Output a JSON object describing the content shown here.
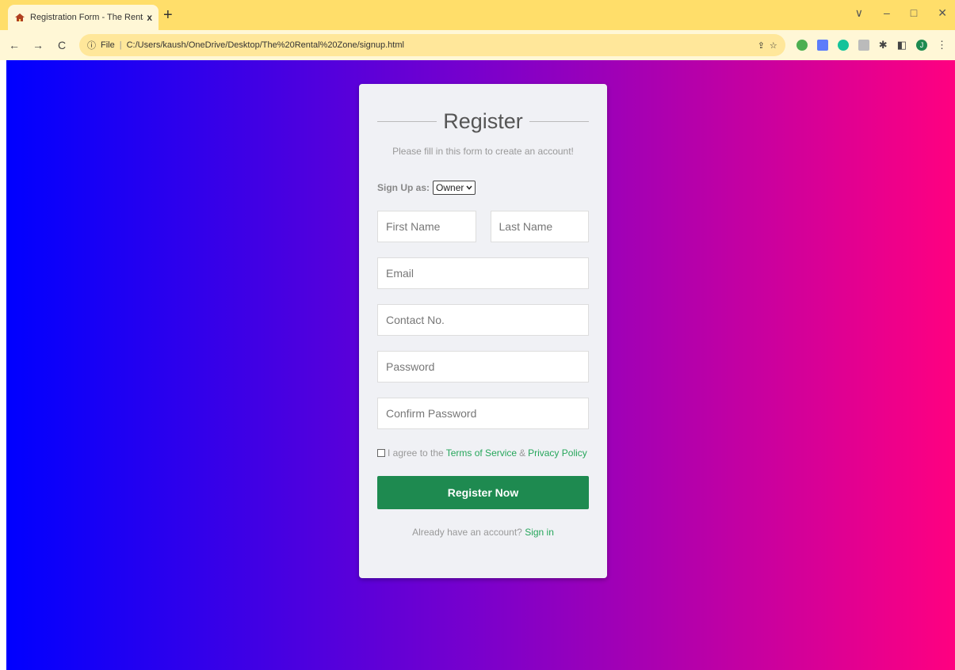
{
  "browser": {
    "tab_title": "Registration Form - The Rental Z",
    "tab_close": "x",
    "new_tab": "+",
    "file_label": "File",
    "url": "C:/Users/kaush/OneDrive/Desktop/The%20Rental%20Zone/signup.html",
    "window": {
      "chevron": "∨",
      "minimize": "–",
      "restore": "□",
      "close": "✕"
    },
    "nav": {
      "back": "←",
      "forward": "→",
      "reload": "C",
      "info": "ⓘ"
    },
    "profile_initial": "J"
  },
  "form": {
    "title": "Register",
    "subtitle": "Please fill in this form to create an account!",
    "signup_as_label": "Sign Up as:",
    "signup_as_value": "Owner",
    "first_name_placeholder": "First Name",
    "last_name_placeholder": "Last Name",
    "email_placeholder": "Email",
    "contact_placeholder": "Contact No.",
    "password_placeholder": "Password",
    "confirm_password_placeholder": "Confirm Password",
    "agree_prefix": "I agree to the",
    "terms_link": "Terms of Service",
    "amp": "&",
    "privacy_link": "Privacy Policy",
    "submit_label": "Register Now",
    "already_text": "Already have an account?",
    "signin_link": "Sign in"
  },
  "colors": {
    "accent": "#1e8a50",
    "link": "#26a65b",
    "gradient_start": "#0000ff",
    "gradient_end": "#ff0080"
  }
}
